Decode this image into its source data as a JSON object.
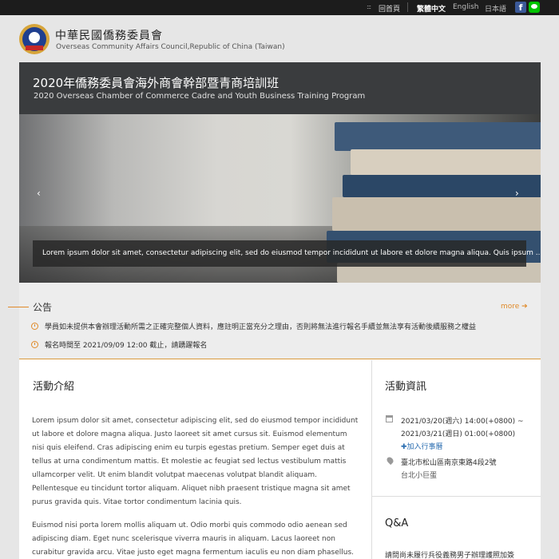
{
  "topbar": {
    "home": "回首頁",
    "languages": [
      "繁體中文",
      "English",
      "日本語"
    ]
  },
  "header": {
    "org_zh": "中華民國僑務委員會",
    "org_en": "Overseas Community Affairs Council,Republic of China (Taiwan)"
  },
  "event": {
    "title_zh": "2020年僑務委員會海外商會幹部暨青商培訓班",
    "title_en": "2020 Overseas Chamber of Commerce Cadre and Youth Business Training Program"
  },
  "banner": {
    "caption": "Lorem ipsum dolor sit amet, consectetur adipiscing elit, sed do eiusmod tempor incididunt ut labore et dolore magna aliqua. Quis ipsum ...",
    "prev": "‹",
    "next": "›"
  },
  "announcement": {
    "title": "公告",
    "more": "more ➔",
    "items": [
      "學員如未提供本會辦理活動所需之正確完整個人資料，應註明正當充分之理由，否則將無法進行報名手續並無法享有活動後續服務之權益",
      "報名時間至 2021/09/09 12:00 截止，請踴躍報名"
    ]
  },
  "intro": {
    "title": "活動介紹",
    "paragraphs": [
      "Lorem ipsum dolor sit amet, consectetur adipiscing elit, sed do eiusmod tempor incididunt ut labore et dolore magna aliqua. Justo laoreet sit amet cursus sit. Euismod elementum nisi quis eleifend. Cras adipiscing enim eu turpis egestas pretium. Semper eget duis at tellus at urna condimentum mattis. Et molestie ac feugiat sed lectus vestibulum mattis ullamcorper velit. Ut enim blandit volutpat maecenas volutpat blandit aliquam. Pellentesque eu tincidunt tortor aliquam. Aliquet nibh praesent tristique magna sit amet purus gravida quis. Vitae tortor condimentum lacinia quis.",
      "Euismod nisi porta lorem mollis aliquam ut. Odio morbi quis commodo odio aenean sed adipiscing diam. Eget nunc scelerisque viverra mauris in aliquam. Lacus laoreet non curabitur gravida arcu. Vitae justo eget magna fermentum iaculis eu non diam phasellus."
    ]
  },
  "info": {
    "title": "活動資訊",
    "date_start": "2021/03/20(週六) 14:00(+0800) ~",
    "date_end": "2021/03/21(週日) 01:00(+0800)",
    "add_calendar": "✚加入行事曆",
    "address": "臺北市松山區南京東路4段2號",
    "venue": "台北小巨蛋",
    "qa_title": "Q&A",
    "qa_text": "請問尚未履行兵役義務男子辦理護照加簽"
  },
  "colors": {
    "accent": "#e08a2a",
    "titlebar": "#3a3c3e",
    "link": "#2a6db0"
  }
}
